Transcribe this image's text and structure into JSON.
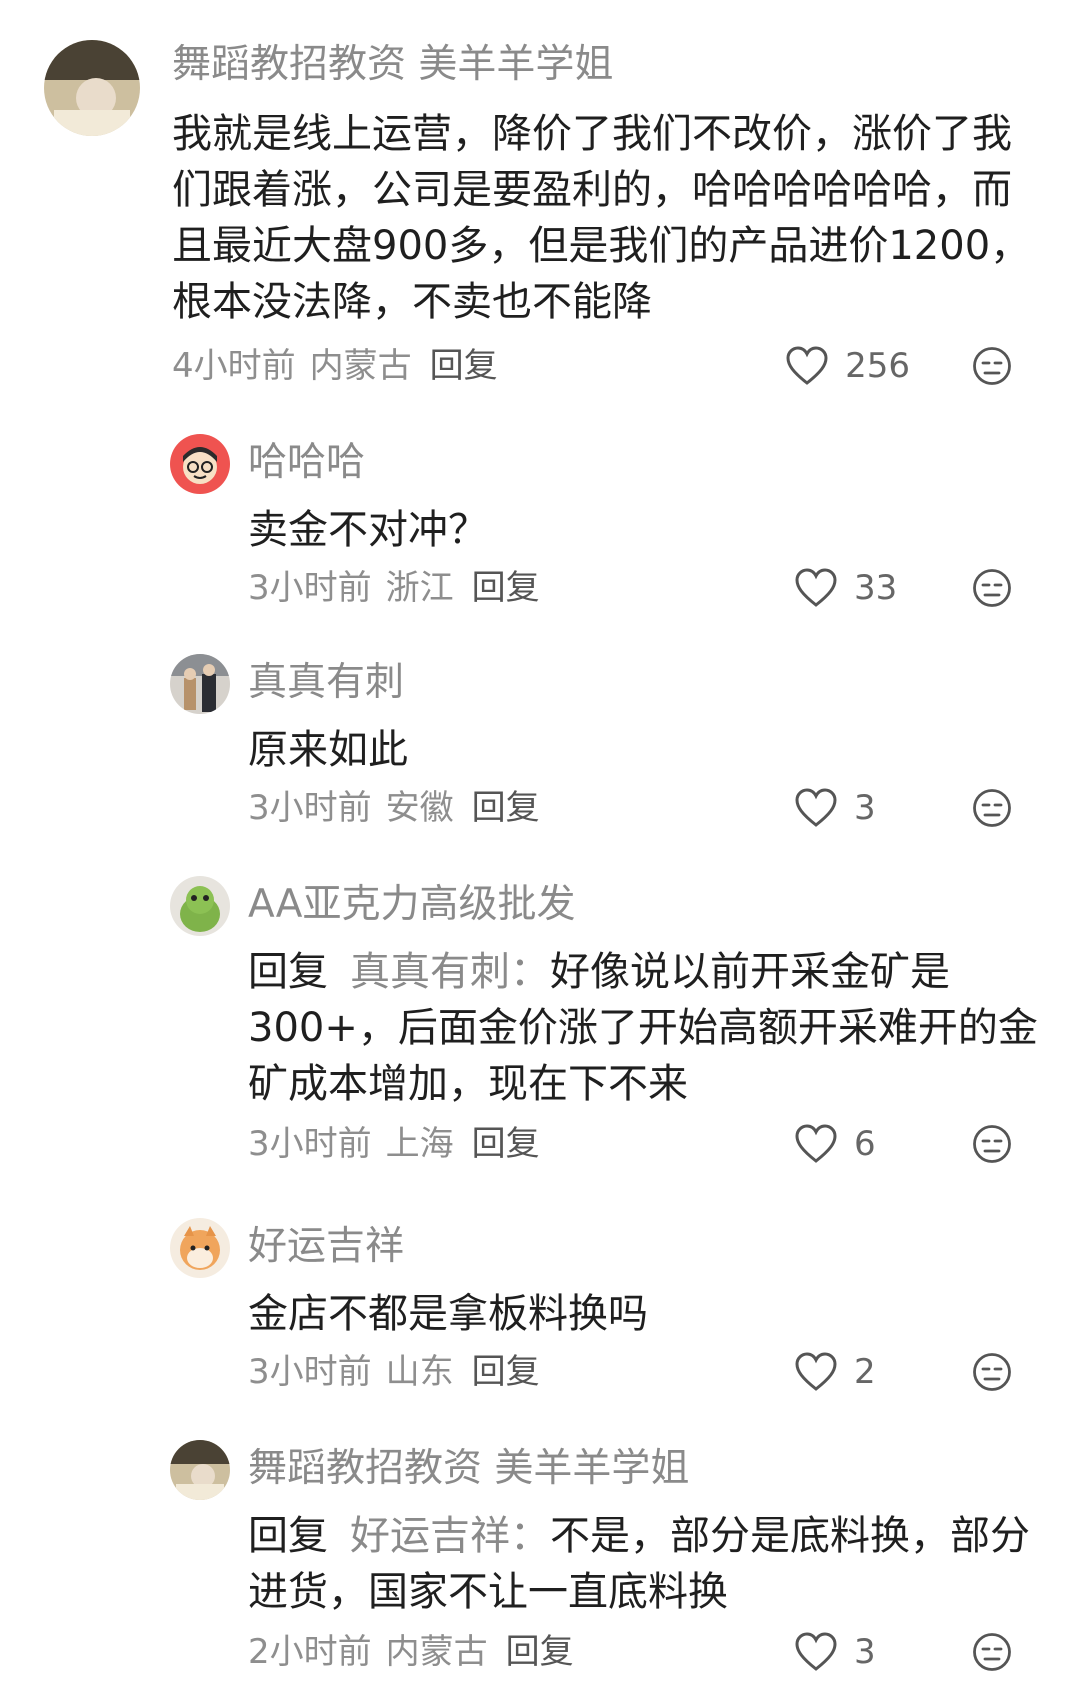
{
  "comments": [
    {
      "username": "舞蹈教招教资 美羊羊学姐",
      "text": "我就是线上运营，降价了我们不改价，涨价了我们跟着涨，公司是要盈利的，哈哈哈哈哈哈，而且最近大盘900多，但是我们的产品进价1200，根本没法降，不卖也不能降",
      "time": "4小时前",
      "location": "内蒙古",
      "reply_label": "回复",
      "likes": "256"
    },
    {
      "username": "哈哈哈",
      "text": "卖金不对冲？",
      "time": "3小时前",
      "location": "浙江",
      "reply_label": "回复",
      "likes": "33"
    },
    {
      "username": "真真有刺",
      "text": "原来如此",
      "time": "3小时前",
      "location": "安徽",
      "reply_label": "回复",
      "likes": "3"
    },
    {
      "username": "AA亚克力高级批发",
      "reply_prefix": "回复",
      "reply_target": "真真有刺：",
      "text": "好像说以前开采金矿是300+，后面金价涨了开始高额开采难开的金矿成本增加，现在下不来",
      "time": "3小时前",
      "location": "上海",
      "reply_label": "回复",
      "likes": "6"
    },
    {
      "username": "好运吉祥",
      "text": "金店不都是拿板料换吗",
      "time": "3小时前",
      "location": "山东",
      "reply_label": "回复",
      "likes": "2"
    },
    {
      "username": "舞蹈教招教资 美羊羊学姐",
      "reply_prefix": "回复",
      "reply_target": "好运吉祥：",
      "text": "不是，部分是底料换，部分进货，国家不让一直底料换",
      "time": "2小时前",
      "location": "内蒙古",
      "reply_label": "回复",
      "likes": "3"
    }
  ],
  "icons": {
    "like": "heart-outline-icon",
    "dislike": "neutral-face-icon"
  },
  "colors": {
    "username": "#8a8a8a",
    "text": "#1f1f1f",
    "meta": "#8e8e8e"
  }
}
